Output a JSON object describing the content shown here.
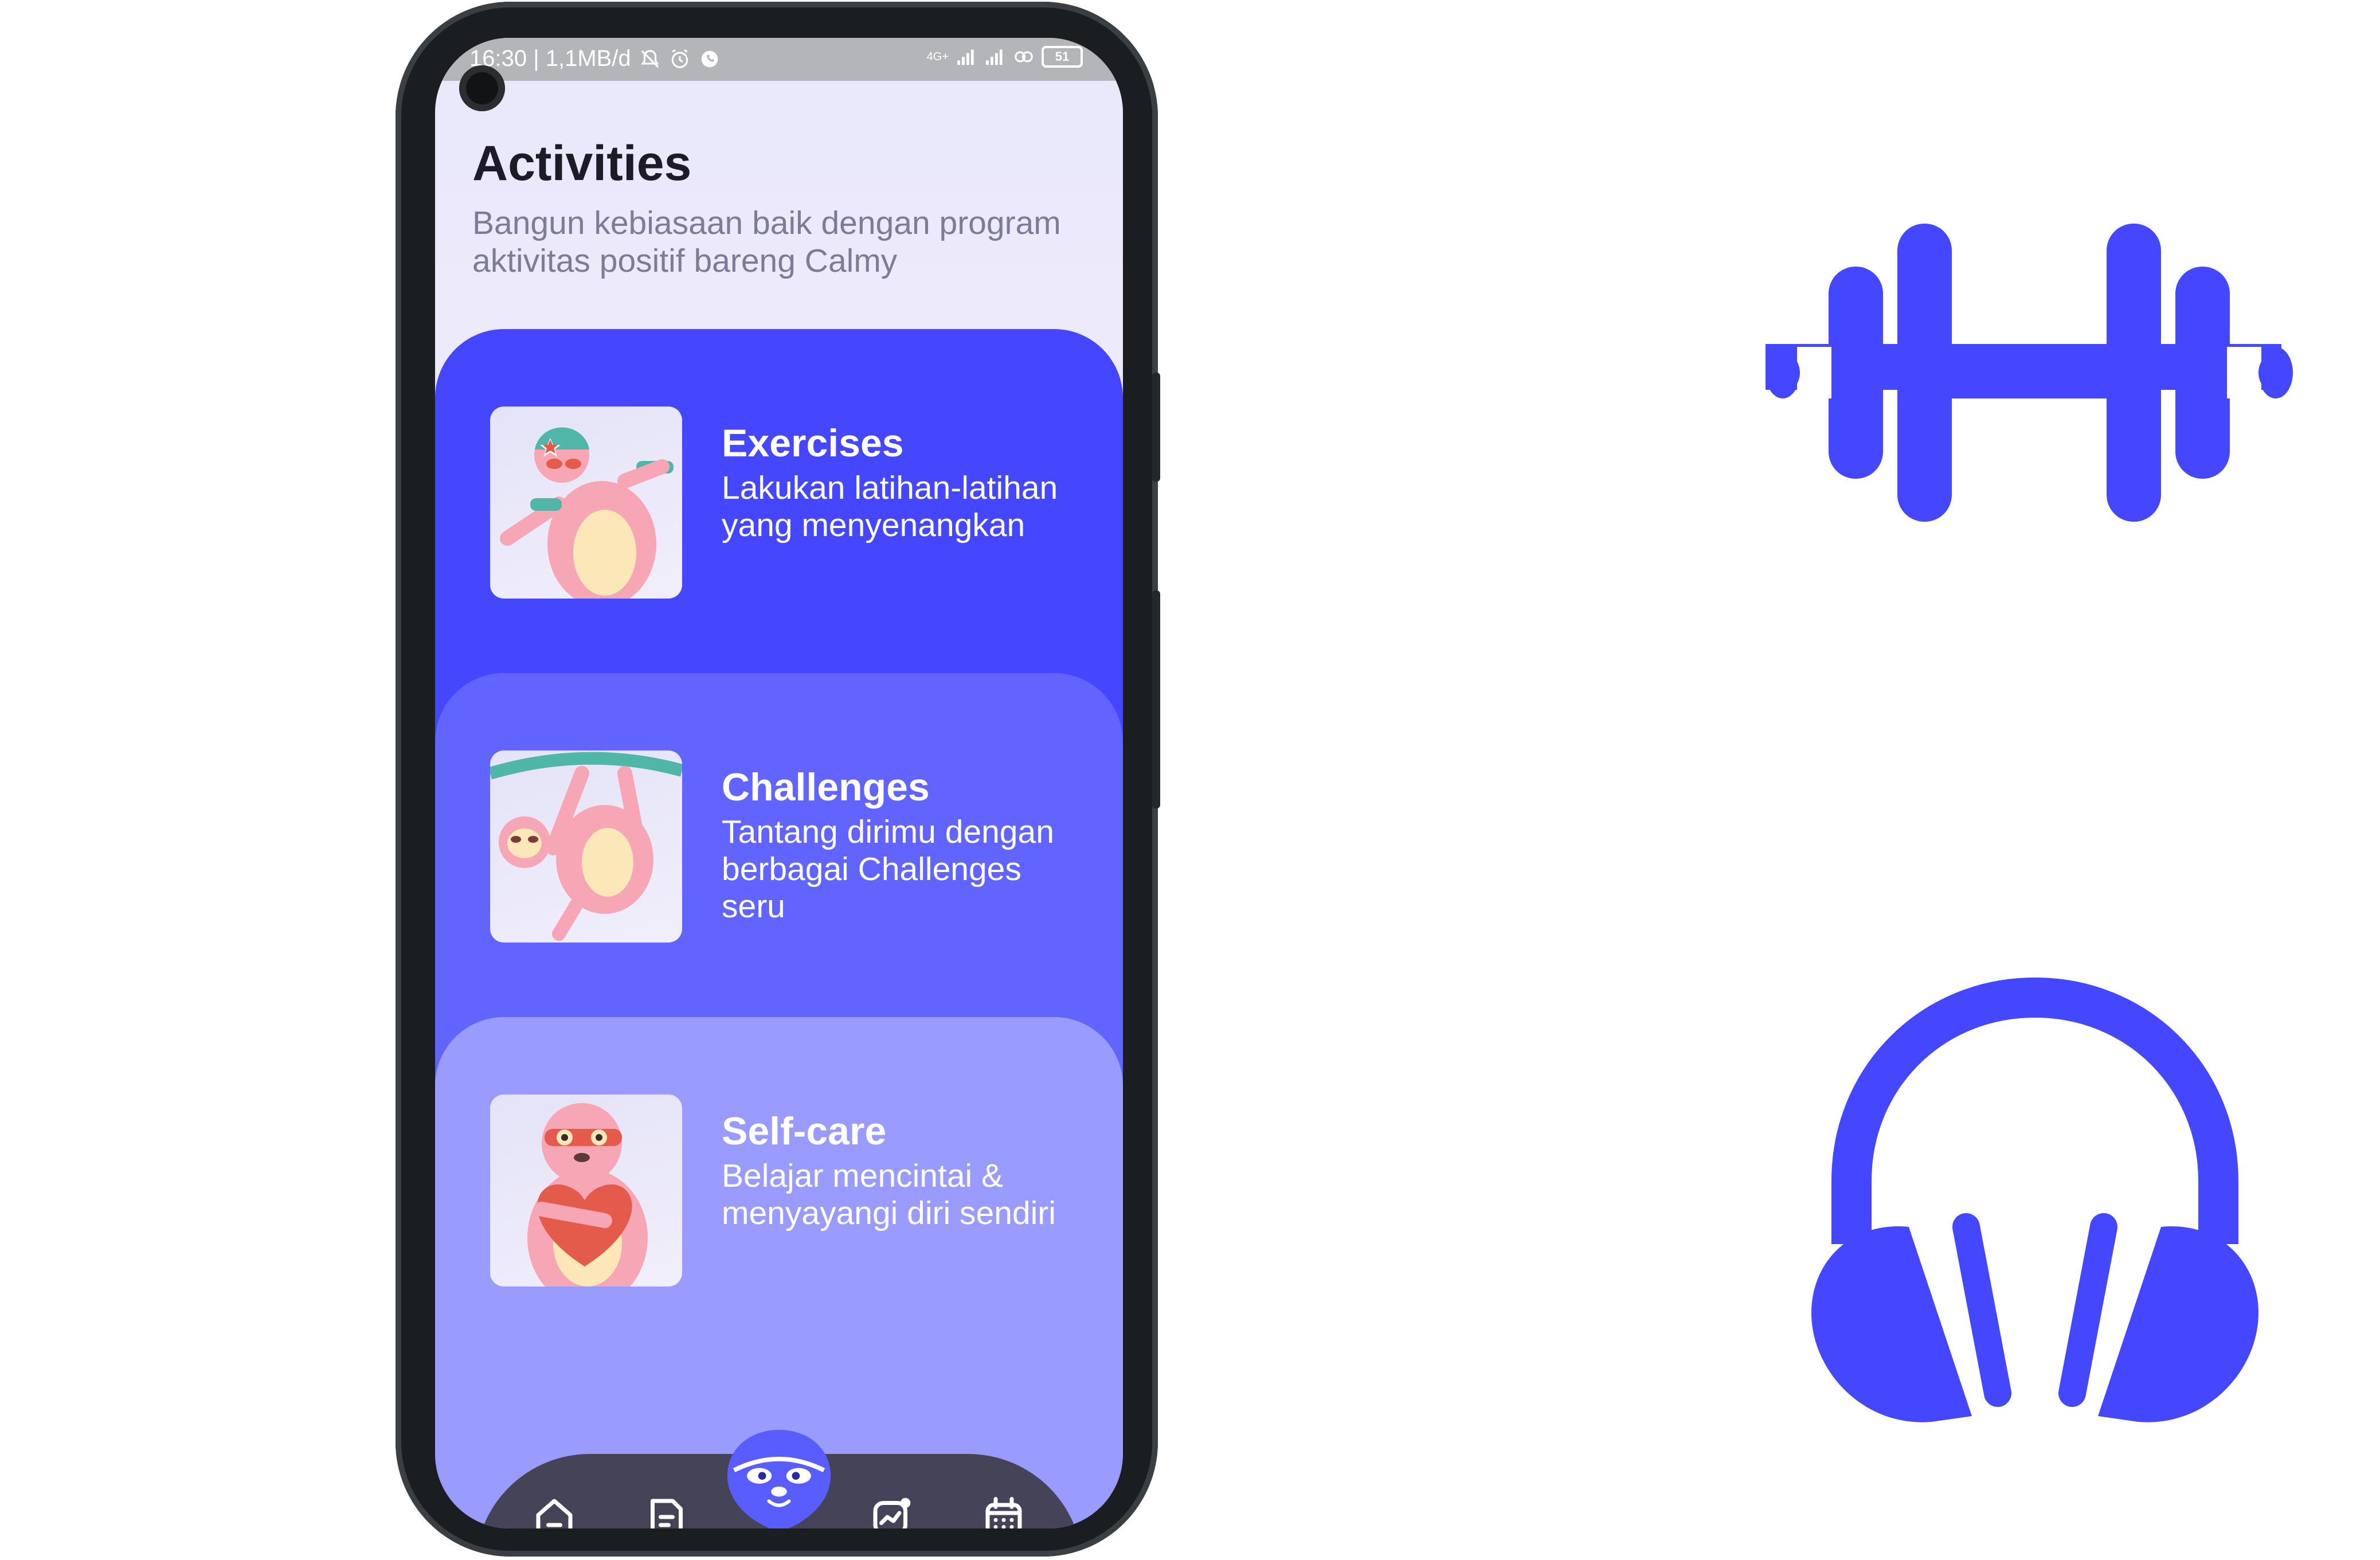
{
  "status_bar": {
    "time_speed": "16:30 | 1,1MB/d",
    "network_label": "4G+",
    "battery": "51"
  },
  "header": {
    "title": "Activities",
    "subtitle": "Bangun kebiasaan baik dengan program aktivitas positif bareng Calmy"
  },
  "cards": [
    {
      "title": "Exercises",
      "description": "Lakukan latihan-latihan yang menyenangkan",
      "color": "#4447fe"
    },
    {
      "title": "Challenges",
      "description": "Tantang dirimu dengan berbagai Challenges seru",
      "color": "#6164fe"
    },
    {
      "title": "Self-care",
      "description": "Belajar mencintai & menyayangi diri sendiri",
      "color": "#999cfe"
    }
  ],
  "bottom_nav": {
    "items": [
      "home-icon",
      "journal-icon",
      "calmy-mascot-icon",
      "stats-icon",
      "calendar-icon"
    ]
  },
  "decor_icons": [
    "dumbbell-icon",
    "headphones-icon"
  ],
  "colors": {
    "accent": "#4447fe",
    "nav_background": "#454358",
    "title_text": "#1c1b27",
    "subtitle_text": "#7d7b96"
  }
}
